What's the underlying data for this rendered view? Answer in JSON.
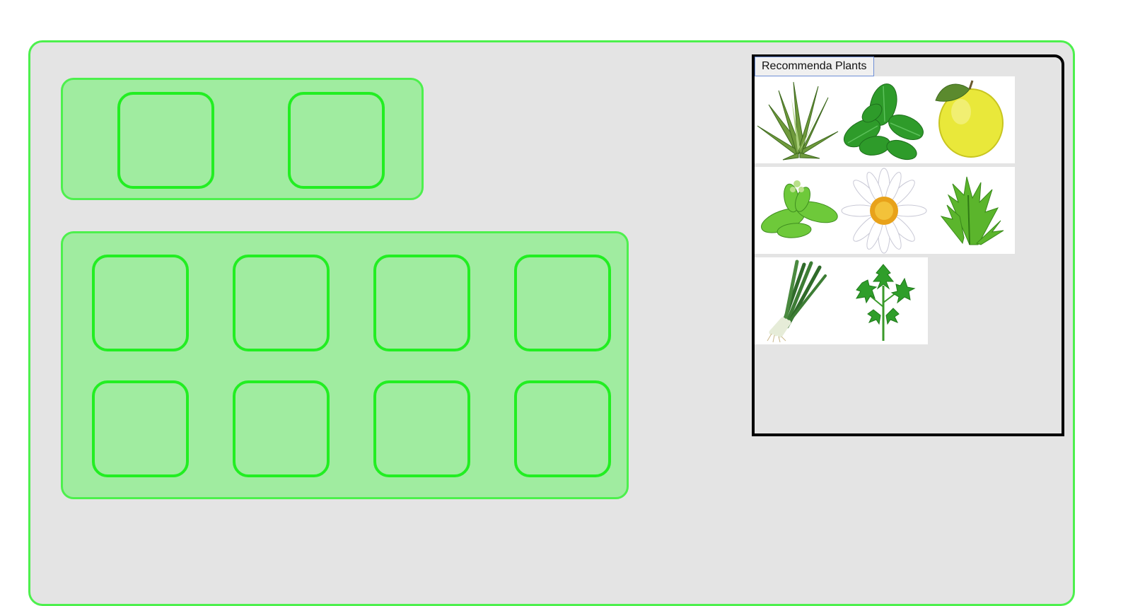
{
  "recommend_button_label": "Recommenda Plants",
  "garden": {
    "small_tray_pot_count": 2,
    "large_tray_pot_count": 8
  },
  "plants": [
    {
      "icon": "aloe-icon"
    },
    {
      "icon": "basil-icon"
    },
    {
      "icon": "lemon-icon"
    },
    {
      "icon": "mint-icon"
    },
    {
      "icon": "chamomile-icon"
    },
    {
      "icon": "arugula-icon"
    },
    {
      "icon": "green-onion-icon"
    },
    {
      "icon": "parsley-icon"
    }
  ],
  "colors": {
    "board_border": "#4df04d",
    "tray_fill": "#a0eca0",
    "pot_border": "#22ee22",
    "board_fill": "#e4e4e4"
  }
}
